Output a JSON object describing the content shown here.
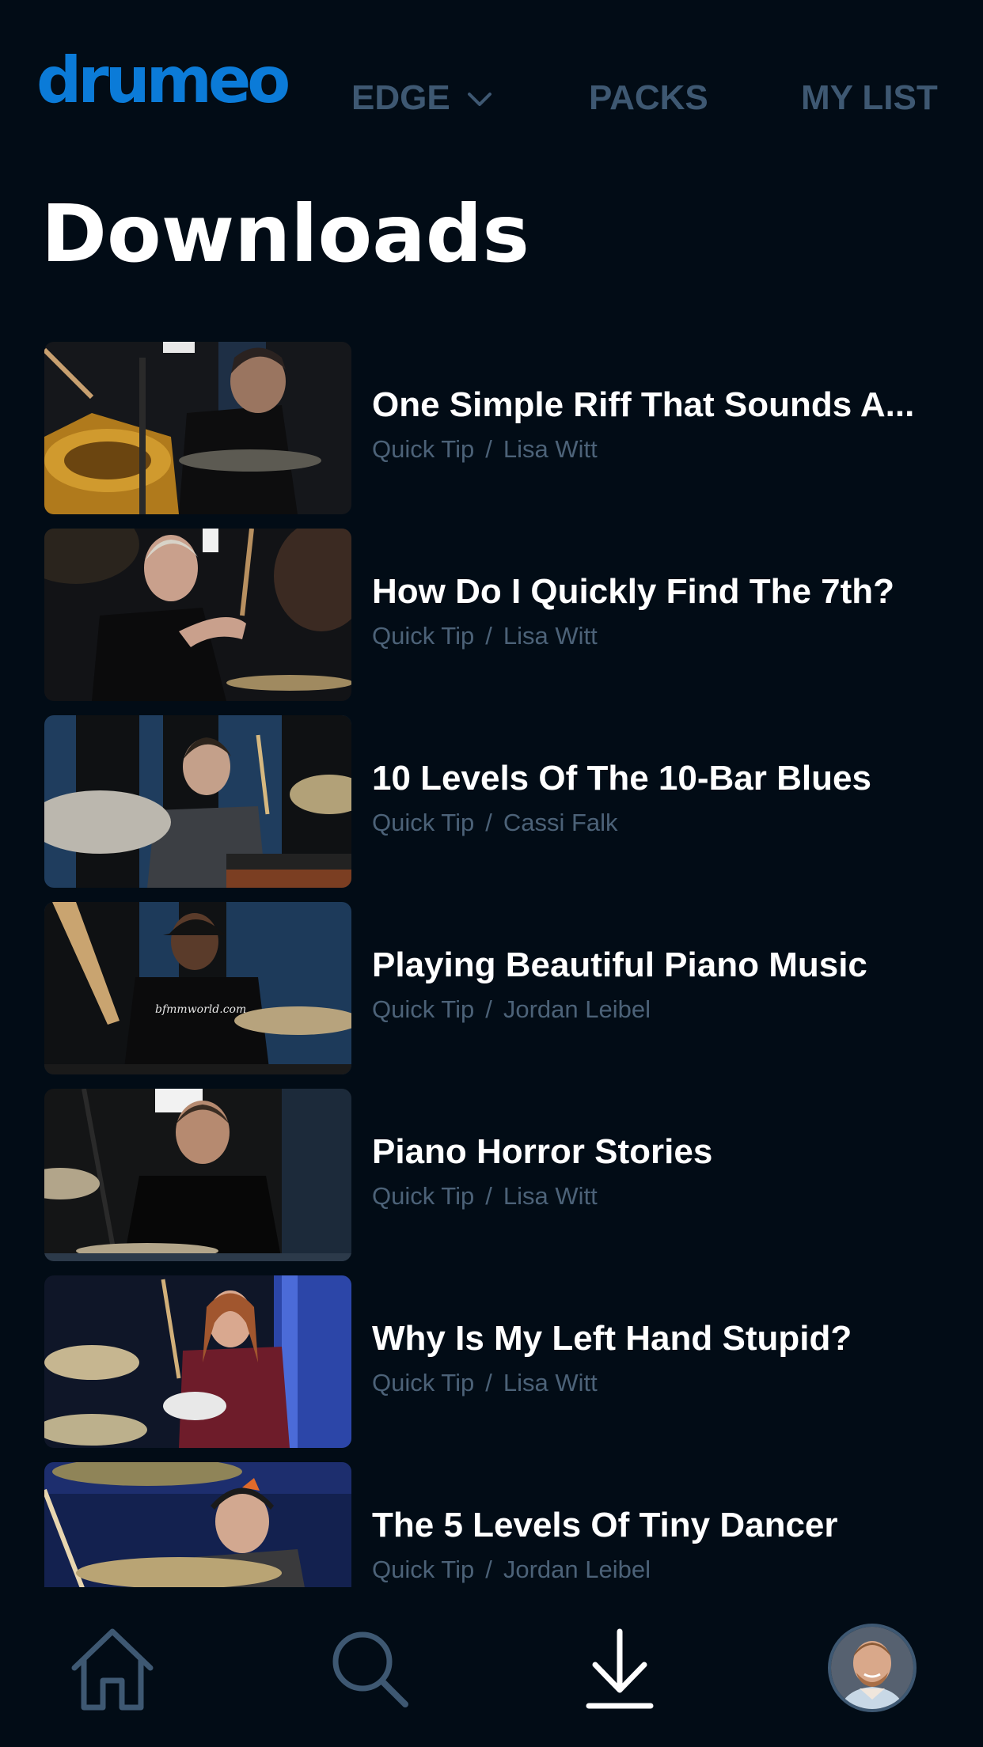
{
  "app": {
    "logo": "drumeo"
  },
  "nav": {
    "items": [
      {
        "label": "EDGE",
        "has_dropdown": true
      },
      {
        "label": "PACKS"
      },
      {
        "label": "MY LIST"
      }
    ]
  },
  "page": {
    "title": "Downloads"
  },
  "downloads": [
    {
      "title": "One Simple Riff That Sounds A...",
      "type": "Quick Tip",
      "instructor": "Lisa Witt"
    },
    {
      "title": "How Do I Quickly Find The 7th?",
      "type": "Quick Tip",
      "instructor": "Lisa Witt"
    },
    {
      "title": "10 Levels Of The 10-Bar Blues",
      "type": "Quick Tip",
      "instructor": "Cassi Falk"
    },
    {
      "title": "Playing Beautiful Piano Music",
      "type": "Quick Tip",
      "instructor": "Jordan Leibel"
    },
    {
      "title": "Piano Horror Stories",
      "type": "Quick Tip",
      "instructor": "Lisa Witt"
    },
    {
      "title": "Why Is My Left Hand Stupid?",
      "type": "Quick Tip",
      "instructor": "Lisa Witt"
    },
    {
      "title": "The 5 Levels Of Tiny Dancer",
      "type": "Quick Tip",
      "instructor": "Jordan Leibel"
    }
  ],
  "meta_separator": "/",
  "tabbar": {
    "tabs": [
      {
        "icon": "home-icon",
        "active": false
      },
      {
        "icon": "search-icon",
        "active": false
      },
      {
        "icon": "download-icon",
        "active": true
      },
      {
        "icon": "profile-avatar",
        "active": false
      }
    ]
  },
  "colors": {
    "background": "#020c16",
    "brand": "#0b7bd8",
    "nav_inactive": "#3e5872",
    "meta_text": "#4c6278",
    "title_text": "#ffffff"
  }
}
